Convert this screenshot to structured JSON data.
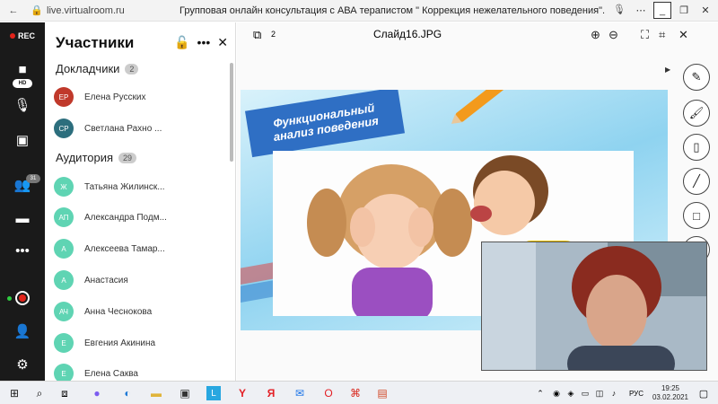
{
  "browser": {
    "url": "live.virtualroom.ru",
    "title": "Групповая онлайн консультация с АВА терапистом \" Коррекция нежелательного поведения\"."
  },
  "rail": {
    "rec_label": "REC",
    "hd_label": "HD",
    "participants_count": "31"
  },
  "panel": {
    "title": "Участники",
    "speakers_label": "Докладчики",
    "speakers_count": "2",
    "audience_label": "Аудитория",
    "audience_count": "29",
    "speakers": [
      {
        "initials": "ЕР",
        "name": "Елена Русских",
        "color": "#c0392b"
      },
      {
        "initials": "СР",
        "name": "Светлана Рахно ...",
        "color": "#2c6e7d"
      }
    ],
    "audience": [
      {
        "initials": "Ж",
        "name": "Татьяна Жилинск...",
        "color": "#5fd4b3"
      },
      {
        "initials": "АП",
        "name": "Александра Подм...",
        "color": "#5fd4b3"
      },
      {
        "initials": "А",
        "name": "Алексеева Тамар...",
        "color": "#5fd4b3"
      },
      {
        "initials": "А",
        "name": "Анастасия",
        "color": "#5fd4b3"
      },
      {
        "initials": "АЧ",
        "name": "Анна Чеснокова",
        "color": "#5fd4b3"
      },
      {
        "initials": "Е",
        "name": "Евгения Акинина",
        "color": "#5fd4b3"
      },
      {
        "initials": "Е",
        "name": "Елена Саква",
        "color": "#5fd4b3"
      }
    ]
  },
  "stage": {
    "slide_count": "2",
    "slide_name": "Слайд16.JPG",
    "slide_title_line1": "Функциональный",
    "slide_title_line2": "анализ поведения"
  },
  "taskbar": {
    "language": "РУС",
    "time": "19:25",
    "date": "03.02.2021",
    "notification_count": "2"
  }
}
